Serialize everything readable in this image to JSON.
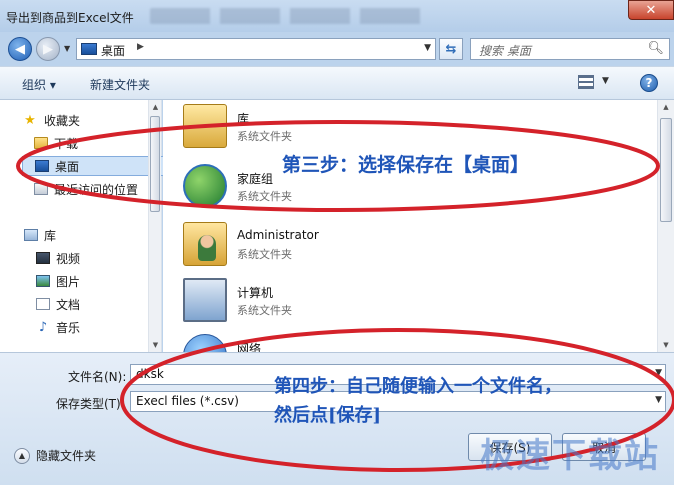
{
  "window": {
    "title": "导出到商品到Excel文件",
    "close_glyph": "✕"
  },
  "nav": {
    "back_glyph": "◀",
    "forward_glyph": "▶",
    "address": "桌面",
    "address_arrow": "▶",
    "refresh_glyph": "⇆",
    "search_placeholder": "搜索 桌面"
  },
  "toolbar": {
    "organize": "组织 ▾",
    "new_folder": "新建文件夹",
    "help": "?"
  },
  "sidebar": {
    "items": [
      {
        "label": "收藏夹",
        "icon": "star-icon"
      },
      {
        "label": "下载",
        "icon": "folder-icon"
      },
      {
        "label": "桌面",
        "icon": "desktop-icon",
        "selected": true
      },
      {
        "label": "最近访问的位置",
        "icon": "recent-places-icon"
      },
      {
        "label": "库",
        "icon": "library-icon"
      },
      {
        "label": "视频",
        "icon": "video-icon"
      },
      {
        "label": "图片",
        "icon": "pictures-icon"
      },
      {
        "label": "文档",
        "icon": "documents-icon"
      },
      {
        "label": "音乐",
        "icon": "music-icon"
      }
    ]
  },
  "files": [
    {
      "name": "库",
      "type": "系统文件夹",
      "icon": "library-folder-icon"
    },
    {
      "name": "家庭组",
      "type": "系统文件夹",
      "icon": "homegroup-icon"
    },
    {
      "name": "Administrator",
      "type": "系统文件夹",
      "icon": "user-folder-icon"
    },
    {
      "name": "计算机",
      "type": "系统文件夹",
      "icon": "computer-icon"
    },
    {
      "name": "网络",
      "type": "",
      "icon": "network-icon"
    }
  ],
  "form": {
    "filename_label": "文件名(N):",
    "filename_value": "dksk",
    "filetype_label": "保存类型(T):",
    "filetype_value": "Execl files (*.csv)",
    "hide_folders": "隐藏文件夹",
    "save_label": "保存(S)",
    "cancel_label": "取消"
  },
  "annotations": {
    "step3": "第三步：选择保存在【桌面】",
    "step4_line1": "第四步：自己随便输入一个文件名，",
    "step4_line2": "然后点[保存]",
    "watermark": "极速下载站",
    "ellipse_color": "#d4222a",
    "text_color": "#1f55b8"
  }
}
